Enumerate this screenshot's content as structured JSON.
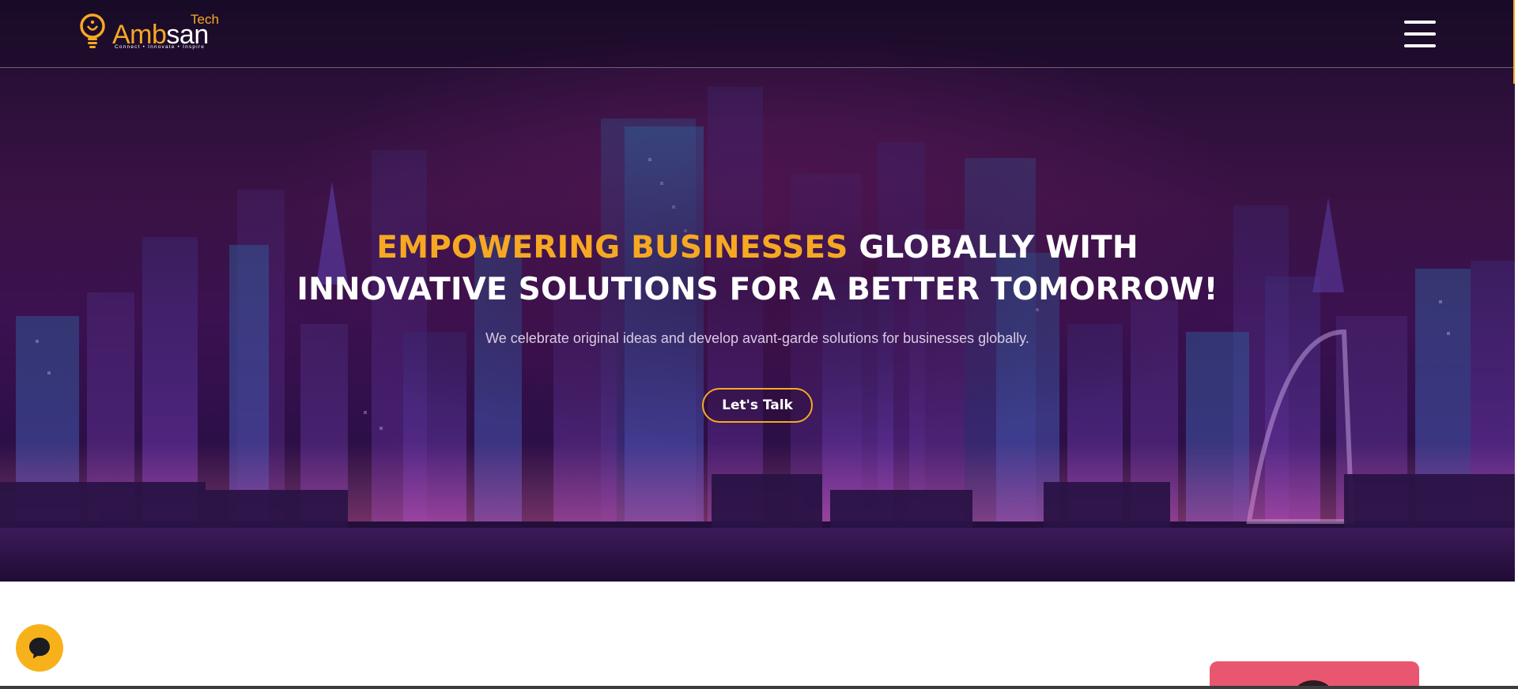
{
  "header": {
    "logo": {
      "tech": "Tech",
      "name_part1": "Amb",
      "name_part2": "san",
      "tagline": "Connect • Innovate • Inspire"
    },
    "menu_icon": "hamburger-menu-icon"
  },
  "hero": {
    "headline_accent": "EMPOWERING BUSINESSES",
    "headline_rest_line1": "GLOBALLY WITH",
    "headline_line2": "INNOVATIVE SOLUTIONS FOR A BETTER TOMORROW!",
    "subtext": "We celebrate original ideas and develop avant-garde solutions for businesses globally.",
    "cta_label": "Let's Talk"
  },
  "chat_widget": {
    "icon": "chat-bubble-icon"
  },
  "colors": {
    "accent": "#f7a823",
    "hero_bg": "#3a1245",
    "text_white": "#ffffff",
    "card_pink": "#e8566f",
    "chat_yellow": "#f7b21b"
  }
}
